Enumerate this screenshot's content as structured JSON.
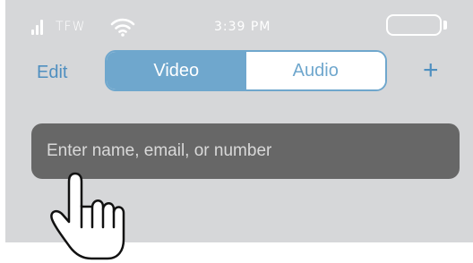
{
  "status_bar": {
    "carrier": "TFW",
    "time": "3:39 PM"
  },
  "nav": {
    "edit_label": "Edit",
    "segments": [
      "Video",
      "Audio"
    ],
    "selected_segment": "Video",
    "add_label": "+"
  },
  "search": {
    "placeholder": "Enter name, email, or number"
  },
  "colors": {
    "accent": "#6fa7cd",
    "link": "#4f8fc0",
    "background": "#d6d7d9",
    "field": "#676767"
  }
}
